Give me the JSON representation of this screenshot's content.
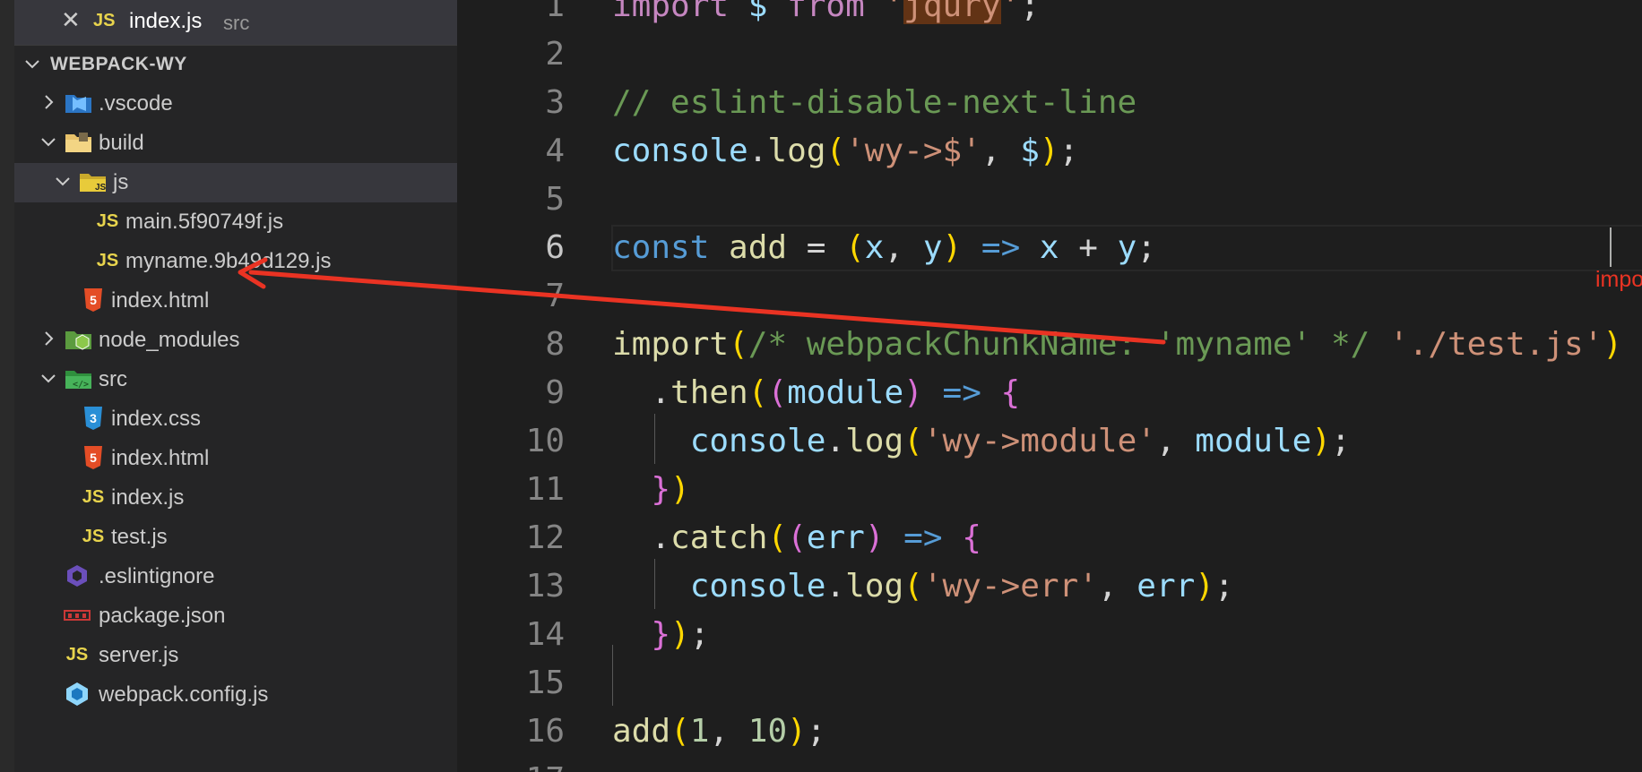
{
  "open_editors": [
    {
      "name": "index.js",
      "dir": "src",
      "icon": "js-icon"
    }
  ],
  "project": {
    "name": "WEBPACK-WY"
  },
  "tree": [
    {
      "label": ".vscode",
      "depth": 0,
      "kind": "folder",
      "expanded": false,
      "icon": "vscode-folder-icon"
    },
    {
      "label": "build",
      "depth": 0,
      "kind": "folder",
      "expanded": true,
      "icon": "build-folder-icon"
    },
    {
      "label": "js",
      "depth": 1,
      "kind": "folder",
      "expanded": true,
      "icon": "js-folder-icon",
      "selected": true
    },
    {
      "label": "main.5f90749f.js",
      "depth": 2,
      "kind": "file",
      "icon": "js-icon"
    },
    {
      "label": "myname.9b49d129.js",
      "depth": 2,
      "kind": "file",
      "icon": "js-icon"
    },
    {
      "label": "index.html",
      "depth": 1,
      "kind": "file",
      "icon": "html-icon"
    },
    {
      "label": "node_modules",
      "depth": 0,
      "kind": "folder",
      "expanded": false,
      "icon": "node-folder-icon"
    },
    {
      "label": "src",
      "depth": 0,
      "kind": "folder",
      "expanded": true,
      "icon": "src-folder-icon"
    },
    {
      "label": "index.css",
      "depth": 1,
      "kind": "file",
      "icon": "css-icon"
    },
    {
      "label": "index.html",
      "depth": 1,
      "kind": "file",
      "icon": "html-icon"
    },
    {
      "label": "index.js",
      "depth": 1,
      "kind": "file",
      "icon": "js-icon"
    },
    {
      "label": "test.js",
      "depth": 1,
      "kind": "file",
      "icon": "js-icon"
    },
    {
      "label": ".eslintignore",
      "depth": 0,
      "kind": "file",
      "icon": "eslint-icon"
    },
    {
      "label": "package.json",
      "depth": 0,
      "kind": "file",
      "icon": "npm-icon"
    },
    {
      "label": "server.js",
      "depth": 0,
      "kind": "file",
      "icon": "js-icon"
    },
    {
      "label": "webpack.config.js",
      "depth": 0,
      "kind": "file",
      "icon": "webpack-icon"
    }
  ],
  "editor": {
    "current_line": 6,
    "lines": [
      {
        "n": "1",
        "tokens": [
          [
            "kw",
            "import "
          ],
          [
            "vr",
            "$ "
          ],
          [
            "kw",
            "from "
          ],
          [
            "st",
            "'"
          ],
          [
            "st hl",
            "jqury"
          ],
          [
            "st",
            "'"
          ],
          [
            "op",
            ";"
          ]
        ]
      },
      {
        "n": "2",
        "tokens": []
      },
      {
        "n": "3",
        "tokens": [
          [
            "cm",
            "// eslint-disable-next-line"
          ]
        ]
      },
      {
        "n": "4",
        "tokens": [
          [
            "vr",
            "console"
          ],
          [
            "op",
            "."
          ],
          [
            "fn",
            "log"
          ],
          [
            "b1",
            "("
          ],
          [
            "st",
            "'wy->$'"
          ],
          [
            "op",
            ", "
          ],
          [
            "vr",
            "$"
          ],
          [
            "b1",
            ")"
          ],
          [
            "op",
            ";"
          ]
        ]
      },
      {
        "n": "5",
        "tokens": []
      },
      {
        "n": "6",
        "tokens": [
          [
            "tp",
            "const "
          ],
          [
            "fn",
            "add "
          ],
          [
            "op",
            "= "
          ],
          [
            "b1",
            "("
          ],
          [
            "vr",
            "x"
          ],
          [
            "op",
            ", "
          ],
          [
            "vr",
            "y"
          ],
          [
            "b1",
            ") "
          ],
          [
            "tp",
            "=> "
          ],
          [
            "vr",
            "x "
          ],
          [
            "op",
            "+ "
          ],
          [
            "vr",
            "y"
          ],
          [
            "op",
            ";"
          ]
        ]
      },
      {
        "n": "7",
        "tokens": []
      },
      {
        "n": "8",
        "tokens": [
          [
            "fn",
            "import"
          ],
          [
            "b1",
            "("
          ],
          [
            "cm",
            "/* webpackChunkName: 'myname' */ "
          ],
          [
            "st",
            "'./test.js'"
          ],
          [
            "b1",
            ")"
          ]
        ]
      },
      {
        "n": "9",
        "tokens": [
          [
            "op",
            "  ."
          ],
          [
            "fn",
            "then"
          ],
          [
            "b1",
            "("
          ],
          [
            "b2",
            "("
          ],
          [
            "vr",
            "module"
          ],
          [
            "b2",
            ") "
          ],
          [
            "tp",
            "=> "
          ],
          [
            "b2",
            "{"
          ]
        ]
      },
      {
        "n": "10",
        "tokens": [
          [
            "op",
            "    "
          ],
          [
            "vr",
            "console"
          ],
          [
            "op",
            "."
          ],
          [
            "fn",
            "log"
          ],
          [
            "b1",
            "("
          ],
          [
            "st",
            "'wy->module'"
          ],
          [
            "op",
            ", "
          ],
          [
            "vr",
            "module"
          ],
          [
            "b1",
            ")"
          ],
          [
            "op",
            ";"
          ]
        ]
      },
      {
        "n": "11",
        "tokens": [
          [
            "op",
            "  "
          ],
          [
            "b2",
            "}"
          ],
          [
            "b1",
            ")"
          ]
        ]
      },
      {
        "n": "12",
        "tokens": [
          [
            "op",
            "  ."
          ],
          [
            "fn",
            "catch"
          ],
          [
            "b1",
            "("
          ],
          [
            "b2",
            "("
          ],
          [
            "vr",
            "err"
          ],
          [
            "b2",
            ") "
          ],
          [
            "tp",
            "=> "
          ],
          [
            "b2",
            "{"
          ]
        ]
      },
      {
        "n": "13",
        "tokens": [
          [
            "op",
            "    "
          ],
          [
            "vr",
            "console"
          ],
          [
            "op",
            "."
          ],
          [
            "fn",
            "log"
          ],
          [
            "b1",
            "("
          ],
          [
            "st",
            "'wy->err'"
          ],
          [
            "op",
            ", "
          ],
          [
            "vr",
            "err"
          ],
          [
            "b1",
            ")"
          ],
          [
            "op",
            ";"
          ]
        ]
      },
      {
        "n": "14",
        "tokens": [
          [
            "op",
            "  "
          ],
          [
            "b2",
            "}"
          ],
          [
            "b1",
            ")"
          ],
          [
            "op",
            ";"
          ]
        ]
      },
      {
        "n": "15",
        "tokens": []
      },
      {
        "n": "16",
        "tokens": [
          [
            "fn",
            "add"
          ],
          [
            "b1",
            "("
          ],
          [
            "nu",
            "1"
          ],
          [
            "op",
            ", "
          ],
          [
            "nu",
            "10"
          ],
          [
            "b1",
            ")"
          ],
          [
            "op",
            ";"
          ]
        ]
      },
      {
        "n": "17",
        "tokens": []
      }
    ]
  },
  "annotation": {
    "text": "import 动态引入，分割自定义代码",
    "color": "#ea3323"
  },
  "colors": {
    "sidebar_bg": "#252526",
    "editor_bg": "#1e1e1e",
    "selection_bg": "#37373d",
    "annotation": "#ea3323"
  }
}
